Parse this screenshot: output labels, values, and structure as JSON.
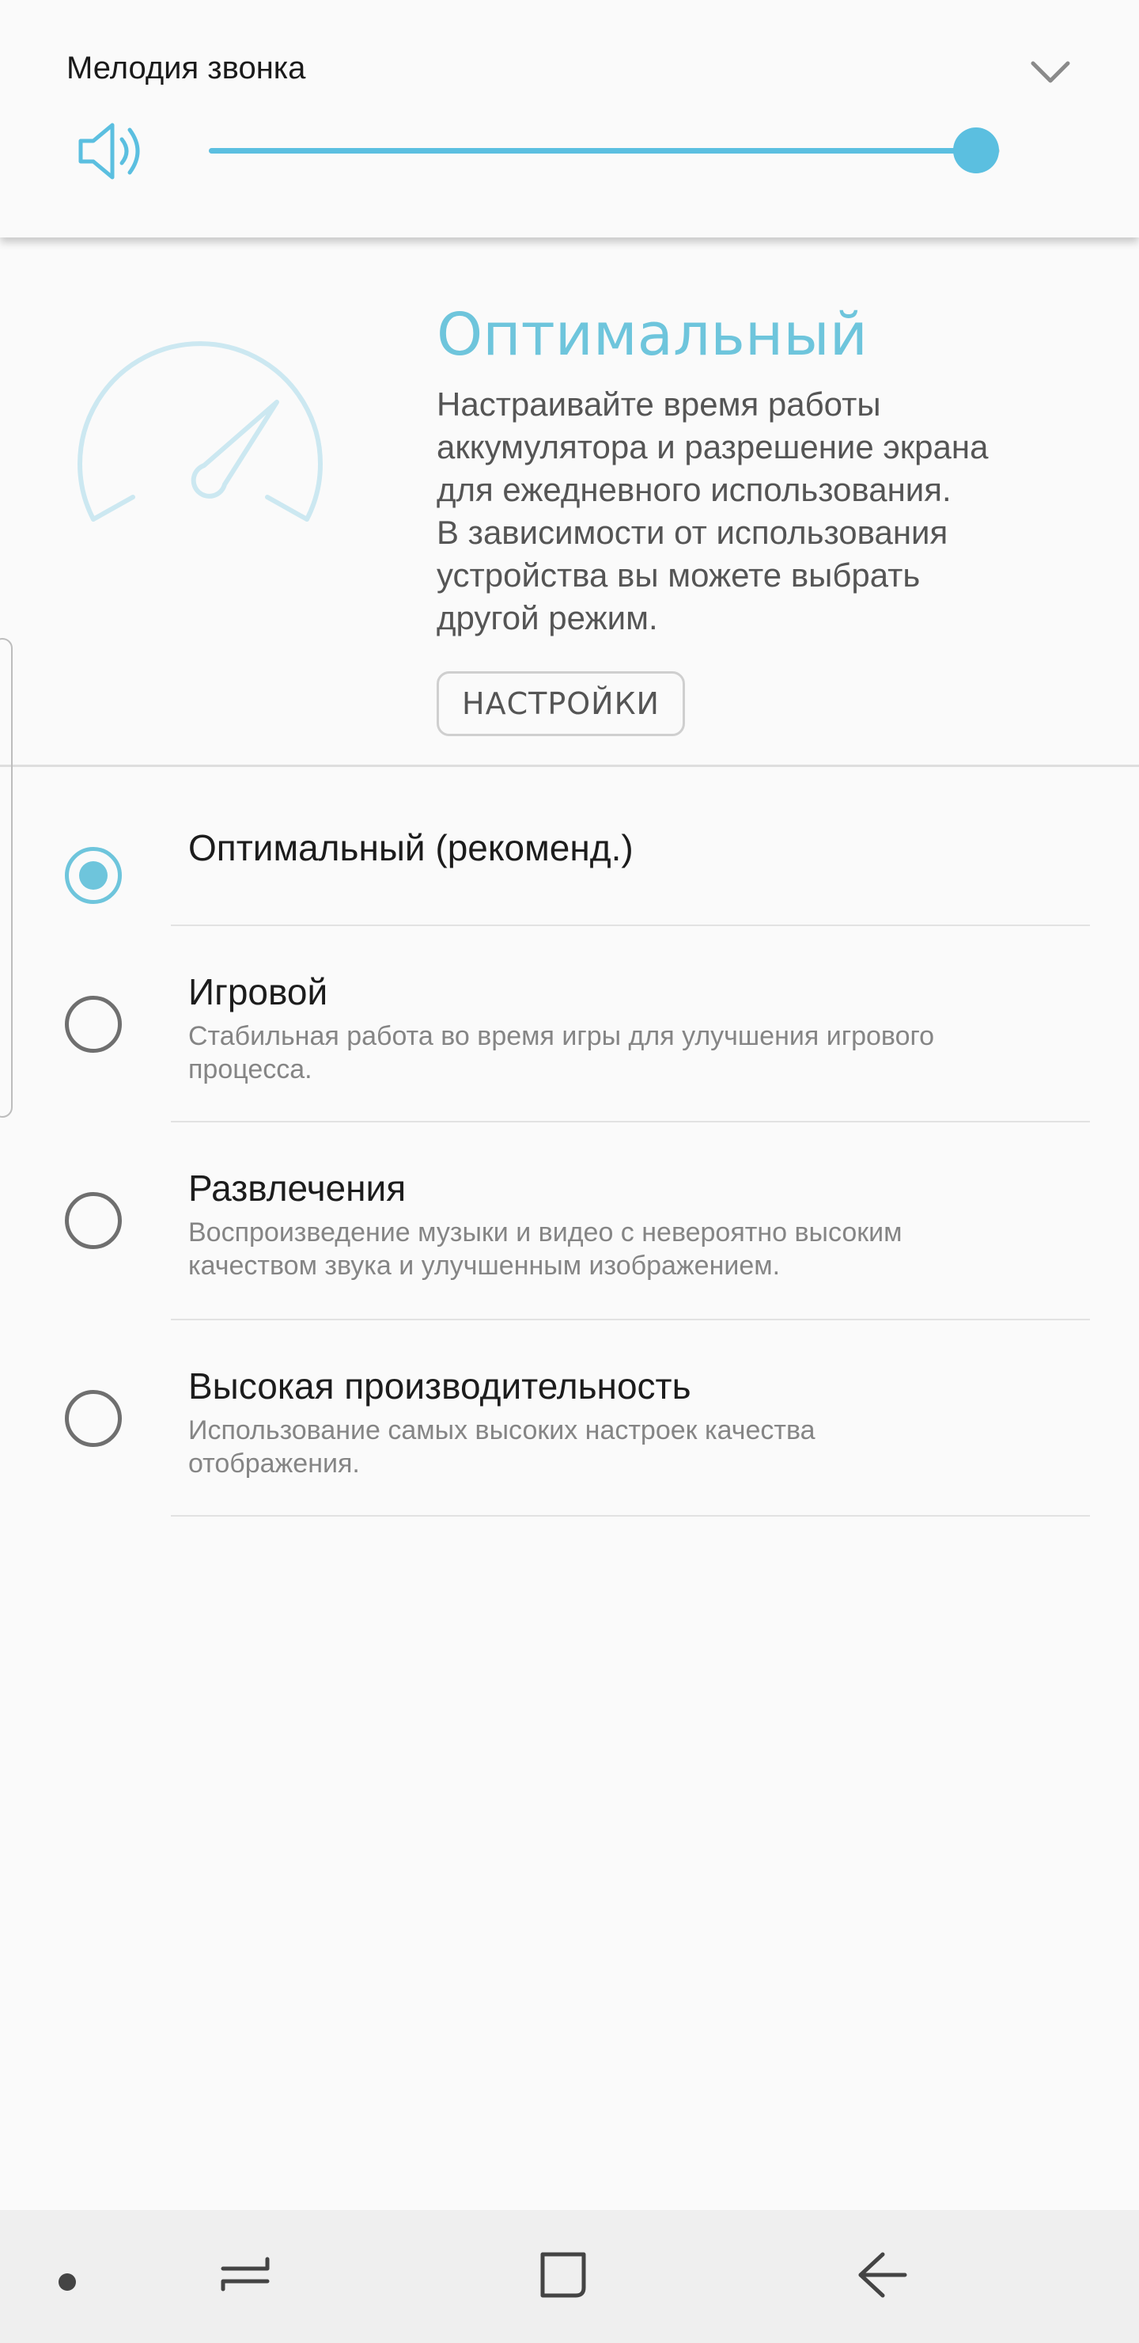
{
  "volume": {
    "title": "Мелодия звонка",
    "level": 0.97,
    "accent_color": "#5bbfe0",
    "icons": [
      "speaker-icon",
      "chevron-down-icon"
    ]
  },
  "mode": {
    "title": "Оптимальный",
    "description": "Настраивайте время работы\nаккумулятора и разрешение экрана\nдля ежедневного использования.\nВ зависимости от использования\nустройства вы можете выбрать\nдругой режим.",
    "settings_label": "НАСТРОЙКИ",
    "accent_color": "#6ec5dc",
    "icon": "gauge-icon"
  },
  "options": [
    {
      "title": "Оптимальный (рекоменд.)",
      "description": "",
      "selected": true
    },
    {
      "title": "Игровой",
      "description": "Стабильная работа во время игры для улучшения игрового\nпроцесса.",
      "selected": false
    },
    {
      "title": "Развлечения",
      "description": "Воспроизведение музыки и видео с невероятно высоким\nкачеством звука и улучшенным изображением.",
      "selected": false
    },
    {
      "title": "Высокая производительность",
      "description": "Использование самых высоких настроек качества\nотображения.",
      "selected": false
    }
  ],
  "navigation": {
    "icons": [
      "dot-icon",
      "recent-apps-icon",
      "home-icon",
      "back-icon"
    ]
  }
}
